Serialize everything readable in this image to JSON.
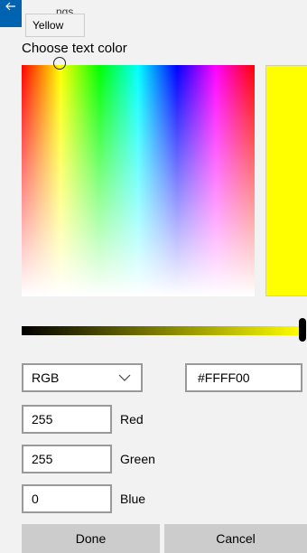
{
  "header": {
    "title_partial": "ngs",
    "back_icon": "arrow-left-icon",
    "tooltip": "Yellow"
  },
  "picker": {
    "heading": "Choose text color",
    "preview_color": "#FFFF00"
  },
  "mode": {
    "selected": "RGB",
    "hex_value": "#FFFF00"
  },
  "channels": [
    {
      "value": "255",
      "label": "Red"
    },
    {
      "value": "255",
      "label": "Green"
    },
    {
      "value": "0",
      "label": "Blue"
    }
  ],
  "buttons": {
    "done": "Done",
    "cancel": "Cancel"
  }
}
